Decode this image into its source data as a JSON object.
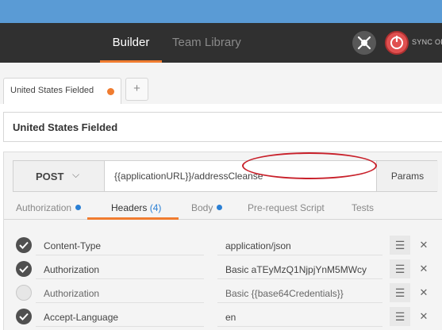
{
  "nav": {
    "tabs": [
      "Builder",
      "Team Library"
    ],
    "sync_label": "SYNC OFF"
  },
  "tabs": {
    "open": [
      {
        "label": "United States Fielded",
        "unsaved_color": "#f07c30"
      }
    ],
    "add_label": "+"
  },
  "request": {
    "name": "United States Fielded",
    "method": "POST",
    "method_chevron": "⌵",
    "url": "{{applicationURL}}/addressCleanse",
    "params_label": "Params"
  },
  "subtabs": {
    "authorization": "Authorization",
    "headers": "Headers",
    "headers_count": "(4)",
    "body": "Body",
    "prerequest": "Pre-request Script",
    "tests": "Tests"
  },
  "headers": [
    {
      "key": "Content-Type",
      "value": "application/json",
      "enabled": true
    },
    {
      "key": "Authorization",
      "value": "Basic aTEyMzQ1NjpjYnM5MWcy",
      "enabled": true
    },
    {
      "key": "Authorization",
      "value": "Basic {{base64Credentials}}",
      "enabled": false
    },
    {
      "key": "Accept-Language",
      "value": "en",
      "enabled": true
    }
  ],
  "icons": {
    "menu": "☰",
    "delete": "✕"
  },
  "colors": {
    "accent": "#f07c30",
    "titlebar": "#5a9bd5",
    "navbar": "#303030",
    "badge_blue": "#2a7fd4",
    "highlight": "#c8202a"
  }
}
